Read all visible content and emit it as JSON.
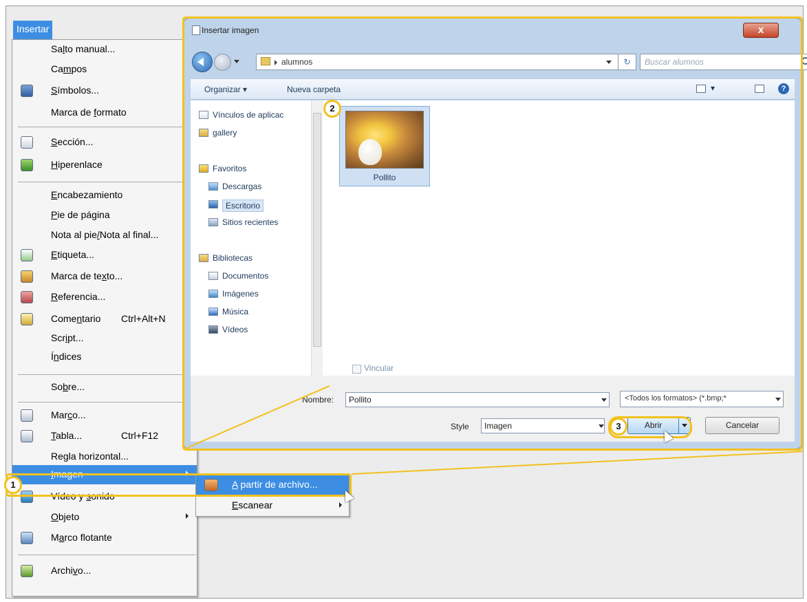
{
  "menu_bar": {
    "active_item": "Insertar"
  },
  "menu": {
    "items": [
      {
        "pre": "Sa",
        "acc": "l",
        "post": "to manual...",
        "shortcut": "",
        "icon": "",
        "arrow": false
      },
      {
        "pre": "Ca",
        "acc": "m",
        "post": "pos",
        "shortcut": "",
        "icon": "",
        "arrow": false
      },
      {
        "pre": "",
        "acc": "S",
        "post": "ímbolos...",
        "shortcut": "",
        "icon": "symbols-icon",
        "arrow": false
      },
      {
        "pre": "Marca de ",
        "acc": "f",
        "post": "ormato",
        "shortcut": "",
        "icon": "",
        "arrow": false
      },
      {
        "pre": "",
        "acc": "S",
        "post": "ección...",
        "shortcut": "",
        "icon": "section-icon",
        "arrow": false
      },
      {
        "pre": "",
        "acc": "H",
        "post": "iperenlace",
        "shortcut": "",
        "icon": "hyperlink-icon",
        "arrow": false
      },
      {
        "pre": "",
        "acc": "E",
        "post": "ncabezamiento",
        "shortcut": "",
        "icon": "",
        "arrow": false
      },
      {
        "pre": "",
        "acc": "P",
        "post": "ie de página",
        "shortcut": "",
        "icon": "",
        "arrow": false
      },
      {
        "pre": "Nota al pie",
        "acc": "/",
        "post": "Nota al final...",
        "shortcut": "",
        "icon": "",
        "arrow": false
      },
      {
        "pre": "",
        "acc": "E",
        "post": "tiqueta...",
        "shortcut": "",
        "icon": "caption-icon",
        "arrow": false
      },
      {
        "pre": "Marca de te",
        "acc": "x",
        "post": "to...",
        "shortcut": "",
        "icon": "bookmark-pin-icon",
        "arrow": false
      },
      {
        "pre": "",
        "acc": "R",
        "post": "eferencia...",
        "shortcut": "",
        "icon": "reference-icon",
        "arrow": false
      },
      {
        "pre": "Come",
        "acc": "n",
        "post": "tario",
        "shortcut": "Ctrl+Alt+N",
        "icon": "comment-icon",
        "arrow": false
      },
      {
        "pre": "Scr",
        "acc": "i",
        "post": "pt...",
        "shortcut": "",
        "icon": "",
        "arrow": false
      },
      {
        "pre": "Í",
        "acc": "n",
        "post": "dices",
        "shortcut": "",
        "icon": "",
        "arrow": false
      },
      {
        "pre": "So",
        "acc": "b",
        "post": "re...",
        "shortcut": "",
        "icon": "",
        "arrow": false
      },
      {
        "pre": "Mar",
        "acc": "c",
        "post": "o...",
        "shortcut": "",
        "icon": "frame-icon",
        "arrow": false
      },
      {
        "pre": "",
        "acc": "T",
        "post": "abla...",
        "shortcut": "Ctrl+F12",
        "icon": "table-icon",
        "arrow": false
      },
      {
        "pre": "Re",
        "acc": "g",
        "post": "la horizontal...",
        "shortcut": "",
        "icon": "",
        "arrow": false
      },
      {
        "pre": "",
        "acc": "I",
        "post": "magen",
        "shortcut": "",
        "icon": "",
        "arrow": true
      },
      {
        "pre": "Vídeo y ",
        "acc": "s",
        "post": "onido",
        "shortcut": "",
        "icon": "video-sound-icon",
        "arrow": false
      },
      {
        "pre": "",
        "acc": "O",
        "post": "bjeto",
        "shortcut": "",
        "icon": "",
        "arrow": true
      },
      {
        "pre": "M",
        "acc": "a",
        "post": "rco flotante",
        "shortcut": "",
        "icon": "floating-frame-icon",
        "arrow": false
      },
      {
        "pre": "Archi",
        "acc": "v",
        "post": "o...",
        "shortcut": "",
        "icon": "insert-file-icon",
        "arrow": false
      }
    ]
  },
  "submenu": {
    "items": [
      {
        "pre": "",
        "acc": "A",
        "post": " partir de archivo...",
        "icon": "image-from-file-icon"
      },
      {
        "pre": "",
        "acc": "E",
        "post": "scanear",
        "icon": ""
      }
    ]
  },
  "dialog": {
    "title": "Insertar imagen",
    "close_label": "x",
    "address_path": "alumnos",
    "search_placeholder": "Buscar alumnos",
    "toolbar": {
      "organize": "Organizar ▾",
      "new_folder": "Nueva carpeta"
    },
    "nav_tree": [
      {
        "label": "Vínculos de aplicac",
        "icon": "page-icon",
        "kind": "item"
      },
      {
        "label": "gallery",
        "icon": "folder-icon",
        "kind": "item"
      },
      {
        "label": "Favoritos",
        "icon": "star-icon",
        "kind": "group"
      },
      {
        "label": "Descargas",
        "icon": "downloads-icon",
        "kind": "item"
      },
      {
        "label": "Escritorio",
        "icon": "desktop-icon",
        "kind": "selected"
      },
      {
        "label": "Sitios recientes",
        "icon": "recent-places-icon",
        "kind": "item"
      },
      {
        "label": "Bibliotecas",
        "icon": "libraries-icon",
        "kind": "group"
      },
      {
        "label": "Documentos",
        "icon": "documents-icon",
        "kind": "item"
      },
      {
        "label": "Imágenes",
        "icon": "pictures-icon",
        "kind": "item"
      },
      {
        "label": "Música",
        "icon": "music-icon",
        "kind": "item"
      },
      {
        "label": "Vídeos",
        "icon": "videos-icon",
        "kind": "item"
      }
    ],
    "file": {
      "name": "Pollito",
      "icon": "chick-image-thumbnail"
    },
    "link_checkbox": {
      "label": "Vincular",
      "checked": false
    },
    "name_label": "Nombre:",
    "name_value": "Pollito",
    "filter_value": "<Todos los formatos> (*.bmp;*",
    "style_label": "Style",
    "style_value": "Imagen",
    "open_button": "Abrir",
    "cancel_button": "Cancelar"
  },
  "annotations": {
    "badge_1": "1",
    "badge_2": "2",
    "badge_3": "3"
  },
  "colors": {
    "highlight": "#3d8ee3",
    "annotation": "#f2c11d",
    "dialog_frame": "#bfd3ea"
  }
}
